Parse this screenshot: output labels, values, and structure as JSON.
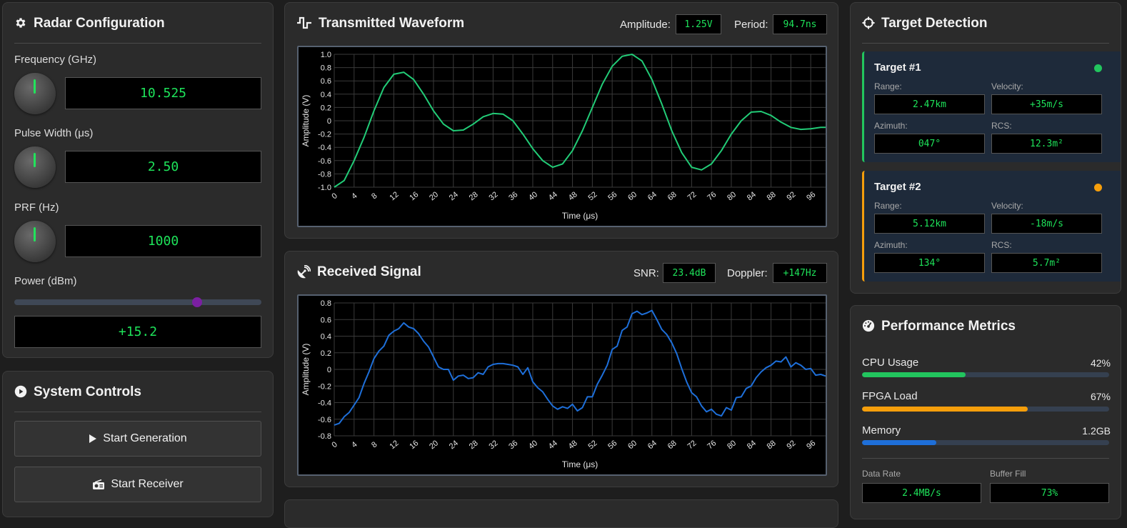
{
  "config": {
    "title": "Radar Configuration",
    "freq_label": "Frequency (GHz)",
    "freq_value": "10.525",
    "pw_label": "Pulse Width (μs)",
    "pw_value": "2.50",
    "prf_label": "PRF (Hz)",
    "prf_value": "1000",
    "power_label": "Power (dBm)",
    "power_value": "+15.2",
    "power_level": 0.74
  },
  "controls": {
    "title": "System Controls",
    "start_generation": "Start Generation",
    "start_receiver": "Start Receiver"
  },
  "tx": {
    "title": "Transmitted Waveform",
    "amp_label": "Amplitude:",
    "amp_value": "1.25V",
    "period_label": "Period:",
    "period_value": "94.7ns"
  },
  "rx": {
    "title": "Received Signal",
    "snr_label": "SNR:",
    "snr_value": "23.4dB",
    "doppler_label": "Doppler:",
    "doppler_value": "+147Hz"
  },
  "targets": {
    "title": "Target Detection",
    "list": [
      {
        "name": "Target #1",
        "range_label": "Range:",
        "range": "2.47km",
        "vel_label": "Velocity:",
        "velocity": "+35m/s",
        "az_label": "Azimuth:",
        "azimuth": "047°",
        "rcs_label": "RCS:",
        "rcs": "12.3m²",
        "color": "#22c55e"
      },
      {
        "name": "Target #2",
        "range_label": "Range:",
        "range": "5.12km",
        "vel_label": "Velocity:",
        "velocity": "-18m/s",
        "az_label": "Azimuth:",
        "azimuth": "134°",
        "rcs_label": "RCS:",
        "rcs": "5.7m²",
        "color": "#f59e0b"
      }
    ]
  },
  "performance": {
    "title": "Performance Metrics",
    "cpu_label": "CPU Usage",
    "cpu_value": "42%",
    "cpu_level": 0.42,
    "cpu_color": "#22c55e",
    "fpga_label": "FPGA Load",
    "fpga_value": "67%",
    "fpga_level": 0.67,
    "fpga_color": "#f59e0b",
    "mem_label": "Memory",
    "mem_value": "1.2GB",
    "mem_level": 0.3,
    "mem_color": "#1e6fd9",
    "rate_label": "Data Rate",
    "rate_value": "2.4MB/s",
    "buffer_label": "Buffer Fill",
    "buffer_value": "73%"
  },
  "chart_data": [
    {
      "type": "line",
      "xlabel": "Time (μs)",
      "ylabel": "Amplitude (V)",
      "xlim": [
        0,
        99
      ],
      "ylim": [
        -1.0,
        1.0
      ],
      "xticks": [
        "0",
        "4",
        "8",
        "12",
        "16",
        "20",
        "24",
        "28",
        "32",
        "36",
        "40",
        "44",
        "48",
        "52",
        "56",
        "60",
        "64",
        "68",
        "72",
        "76",
        "80",
        "84",
        "88",
        "92",
        "96"
      ],
      "yticks": [
        "1.0",
        "0.8",
        "0.6",
        "0.4",
        "0.2",
        "0",
        "-0.2",
        "-0.4",
        "-0.6",
        "-0.8",
        "-1.0"
      ],
      "grid": true,
      "color": "#22cc77",
      "x": [
        0,
        2,
        4,
        6,
        8,
        10,
        12,
        14,
        16,
        18,
        20,
        22,
        24,
        26,
        28,
        30,
        32,
        34,
        36,
        38,
        40,
        42,
        44,
        46,
        48,
        50,
        52,
        54,
        56,
        58,
        60,
        62,
        64,
        66,
        68,
        70,
        72,
        74,
        76,
        78,
        80,
        82,
        84,
        86,
        88,
        90,
        92,
        94,
        96,
        98,
        99
      ],
      "y": [
        -1.0,
        -0.9,
        -0.6,
        -0.25,
        0.15,
        0.5,
        0.7,
        0.73,
        0.62,
        0.4,
        0.15,
        -0.05,
        -0.15,
        -0.14,
        -0.05,
        0.06,
        0.11,
        0.1,
        0.0,
        -0.2,
        -0.42,
        -0.6,
        -0.7,
        -0.65,
        -0.45,
        -0.15,
        0.2,
        0.55,
        0.82,
        0.97,
        1.0,
        0.9,
        0.62,
        0.25,
        -0.15,
        -0.48,
        -0.7,
        -0.74,
        -0.65,
        -0.45,
        -0.2,
        0.0,
        0.13,
        0.14,
        0.08,
        -0.02,
        -0.1,
        -0.13,
        -0.12,
        -0.1,
        -0.1
      ]
    },
    {
      "type": "line",
      "xlabel": "Time (μs)",
      "ylabel": "Amplitude (V)",
      "xlim": [
        0,
        99
      ],
      "ylim": [
        -0.8,
        0.8
      ],
      "xticks": [
        "0",
        "4",
        "8",
        "12",
        "16",
        "20",
        "24",
        "28",
        "32",
        "36",
        "40",
        "44",
        "48",
        "52",
        "56",
        "60",
        "64",
        "68",
        "72",
        "76",
        "80",
        "84",
        "88",
        "92",
        "96"
      ],
      "yticks": [
        "0.8",
        "0.6",
        "0.4",
        "0.2",
        "0",
        "-0.2",
        "-0.4",
        "-0.6",
        "-0.8"
      ],
      "grid": true,
      "color": "#1e6fd9",
      "x": [
        0,
        1,
        2,
        3,
        4,
        5,
        6,
        7,
        8,
        9,
        10,
        11,
        12,
        13,
        14,
        15,
        16,
        17,
        18,
        19,
        20,
        21,
        22,
        23,
        24,
        25,
        26,
        27,
        28,
        29,
        30,
        31,
        32,
        33,
        34,
        35,
        36,
        37,
        38,
        39,
        40,
        41,
        42,
        43,
        44,
        45,
        46,
        47,
        48,
        49,
        50,
        51,
        52,
        53,
        54,
        55,
        56,
        57,
        58,
        59,
        60,
        61,
        62,
        63,
        64,
        65,
        66,
        67,
        68,
        69,
        70,
        71,
        72,
        73,
        74,
        75,
        76,
        77,
        78,
        79,
        80,
        81,
        82,
        83,
        84,
        85,
        86,
        87,
        88,
        89,
        90,
        91,
        92,
        93,
        94,
        95,
        96,
        97,
        98,
        99
      ],
      "y": [
        -0.67,
        -0.65,
        -0.57,
        -0.52,
        -0.43,
        -0.34,
        -0.17,
        -0.03,
        0.13,
        0.22,
        0.28,
        0.41,
        0.46,
        0.49,
        0.56,
        0.51,
        0.49,
        0.43,
        0.34,
        0.27,
        0.15,
        0.03,
        0.0,
        0.0,
        -0.13,
        -0.08,
        -0.07,
        -0.11,
        -0.1,
        -0.04,
        -0.06,
        0.03,
        0.06,
        0.07,
        0.07,
        0.06,
        0.05,
        0.03,
        -0.06,
        0.02,
        -0.15,
        -0.22,
        -0.27,
        -0.36,
        -0.44,
        -0.48,
        -0.45,
        -0.47,
        -0.42,
        -0.5,
        -0.46,
        -0.33,
        -0.33,
        -0.18,
        -0.07,
        0.05,
        0.24,
        0.28,
        0.47,
        0.51,
        0.67,
        0.7,
        0.66,
        0.68,
        0.71,
        0.6,
        0.48,
        0.42,
        0.32,
        0.19,
        0.01,
        -0.15,
        -0.28,
        -0.33,
        -0.44,
        -0.51,
        -0.48,
        -0.54,
        -0.56,
        -0.46,
        -0.49,
        -0.34,
        -0.33,
        -0.23,
        -0.2,
        -0.1,
        -0.03,
        0.02,
        0.05,
        0.1,
        0.09,
        0.15,
        0.03,
        0.08,
        0.05,
        0.0,
        0.01,
        -0.07,
        -0.06,
        -0.08
      ]
    }
  ]
}
